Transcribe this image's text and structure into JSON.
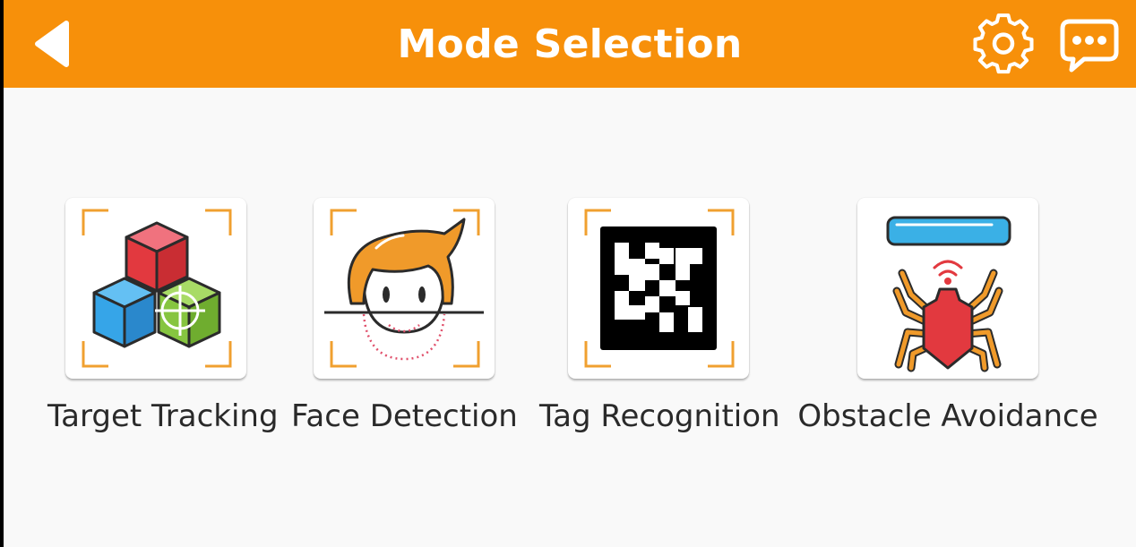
{
  "header": {
    "title": "Mode Selection",
    "back_icon": "back-arrow-icon",
    "settings_icon": "gear-icon",
    "chat_icon": "chat-bubble-icon",
    "color": "#f7900a"
  },
  "modes": [
    {
      "label": "Target Tracking",
      "icon": "color-cubes-target-icon"
    },
    {
      "label": "Face Detection",
      "icon": "face-scan-icon"
    },
    {
      "label": "Tag Recognition",
      "icon": "ar-tag-icon"
    },
    {
      "label": "Obstacle Avoidance",
      "icon": "spider-sensor-icon"
    }
  ]
}
